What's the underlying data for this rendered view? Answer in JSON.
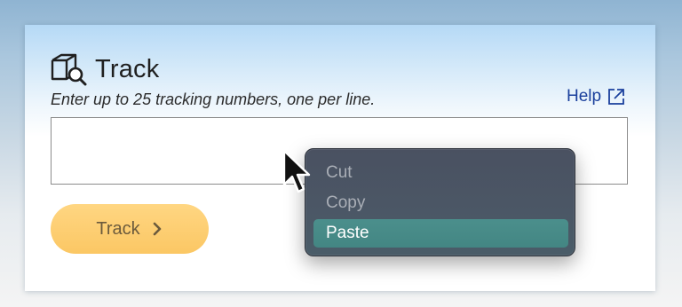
{
  "tracking_panel": {
    "title": "Track",
    "title_icon": "package-search-icon",
    "instructions": "Enter up to 25 tracking numbers, one per line.",
    "help_link": {
      "label": "Help",
      "icon": "external-link-icon"
    },
    "input": {
      "value": "",
      "placeholder": ""
    },
    "track_button": {
      "label": "Track",
      "icon": "chevron-right-icon"
    }
  },
  "context_menu": {
    "items": [
      {
        "label": "Cut",
        "state": "disabled"
      },
      {
        "label": "Copy",
        "state": "disabled"
      },
      {
        "label": "Paste",
        "state": "highlighted"
      }
    ]
  },
  "colors": {
    "link": "#1a3f9c",
    "button": "#fbc764",
    "menu_background": "#4b5665",
    "menu_highlight": "#438683"
  }
}
